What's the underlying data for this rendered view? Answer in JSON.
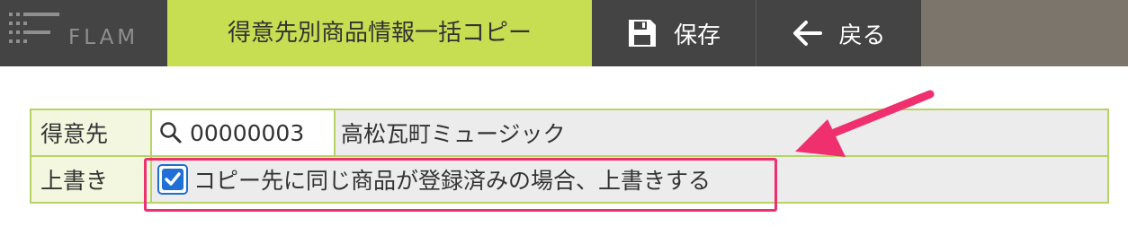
{
  "header": {
    "logo_text": "FLAM",
    "title": "得意先別商品情報一括コピー",
    "save_label": "保存",
    "back_label": "戻る"
  },
  "form": {
    "customer_label": "得意先",
    "customer_code": "00000003",
    "customer_name": "高松瓦町ミュージック",
    "overwrite_label": "上書き",
    "overwrite_checked": true,
    "overwrite_text": "コピー先に同じ商品が登録済みの場合、上書きする"
  },
  "colors": {
    "accent_green": "#c7dd52",
    "header_dark": "#444444",
    "highlight_pink": "#ef2f6e",
    "checkbox_blue": "#1f6fd6"
  },
  "icons": [
    "logo-icon",
    "save-icon",
    "back-arrow-icon",
    "search-icon",
    "check-icon",
    "annotation-arrow-icon"
  ]
}
